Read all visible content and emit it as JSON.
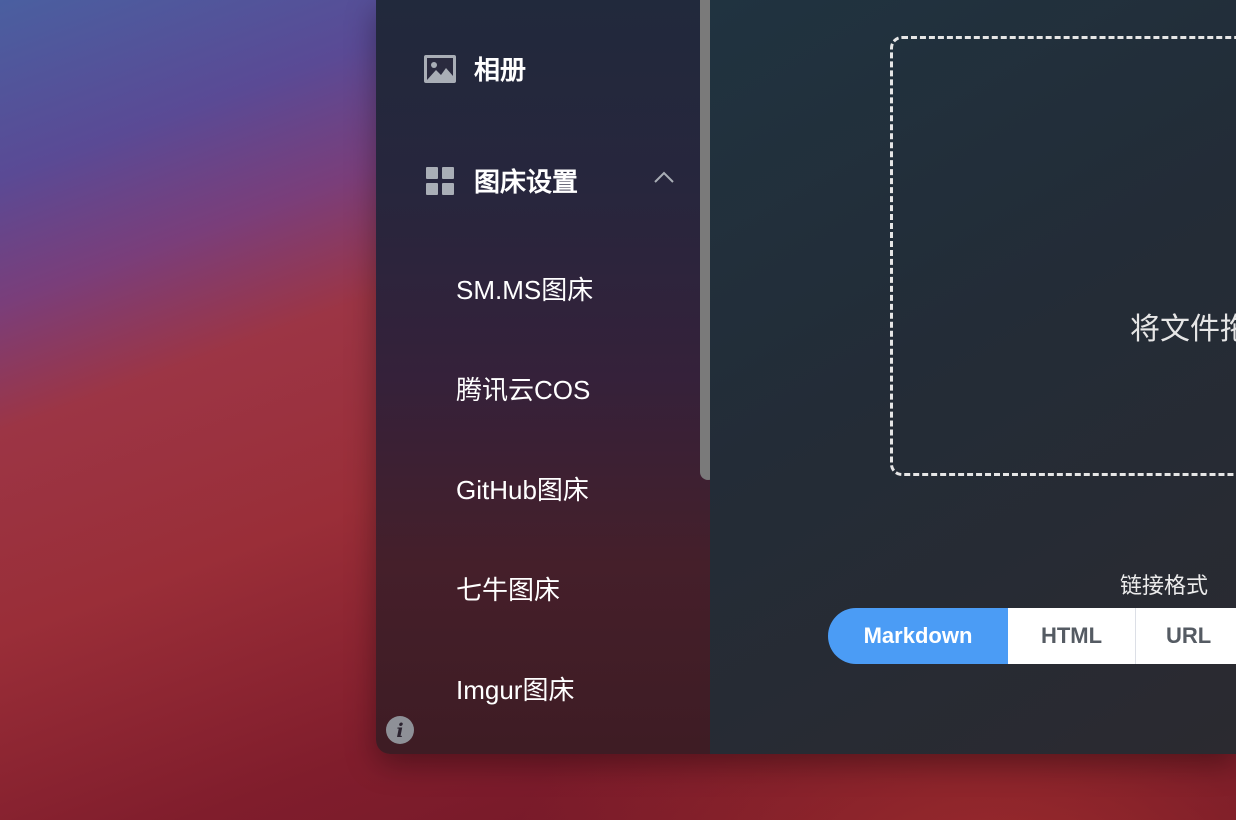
{
  "sidebar": {
    "items": [
      {
        "icon": "image-icon",
        "label": "相册"
      },
      {
        "icon": "grid-icon",
        "label": "图床设置",
        "expanded": true
      }
    ],
    "subitems": [
      {
        "label": "SM.MS图床"
      },
      {
        "label": "腾讯云COS"
      },
      {
        "label": "GitHub图床"
      },
      {
        "label": "七牛图床"
      },
      {
        "label": "Imgur图床"
      }
    ],
    "footer_icon": "info-icon"
  },
  "main": {
    "drop_text": "将文件拖",
    "link_format": {
      "label": "链接格式",
      "options": [
        "Markdown",
        "HTML",
        "URL"
      ],
      "selected": "Markdown"
    }
  },
  "colors": {
    "accent": "#4b9cf5",
    "sidebar_text": "#ffffff",
    "icon_gray": "#a9aeb6"
  }
}
